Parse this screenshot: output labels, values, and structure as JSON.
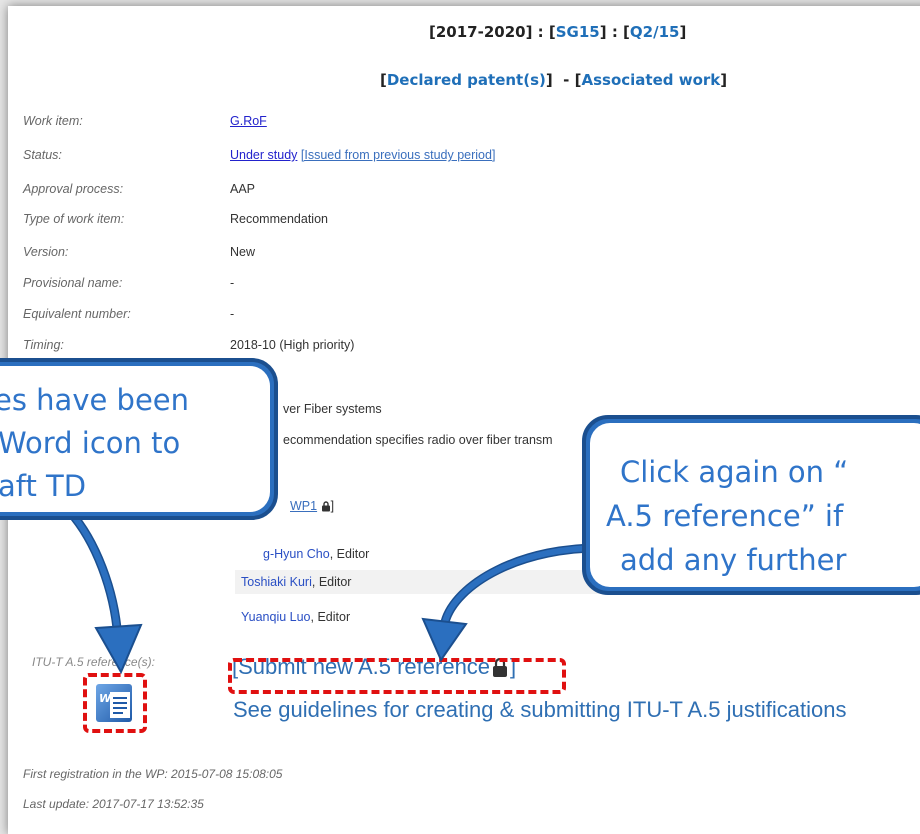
{
  "header": {
    "period": "[2017-2020]",
    "sep1": " : [",
    "study_group": "SG15",
    "sep2": "] : [",
    "question": "Q2/15",
    "end": "]"
  },
  "links": {
    "declared_patents": "Declared patent(s)",
    "associated_work": "Associated work"
  },
  "fields": [
    {
      "label": "Work item:",
      "value": "G.RoF"
    },
    {
      "label": "Status:",
      "value": "Under study",
      "extra": "[Issued from previous study period]"
    },
    {
      "label": "Approval process:",
      "value": "AAP"
    },
    {
      "label": "Type of work item:",
      "value": "Recommendation"
    },
    {
      "label": "Version:",
      "value": "New"
    },
    {
      "label": "Provisional name:",
      "value": "-"
    },
    {
      "label": "Equivalent number:",
      "value": "-"
    },
    {
      "label": "Timing:",
      "value": "2018-10 (High priority)"
    }
  ],
  "partial": {
    "subject": "ver Fiber systems",
    "summary": "ecommendation specifies radio over fiber transm",
    "wp_group": "WP1"
  },
  "editors": [
    {
      "name": "g-Hyun Cho",
      "role": ", Editor"
    },
    {
      "name": "Toshiaki Kuri",
      "role": ", Editor"
    },
    {
      "name": "Yuanqiu Luo",
      "role": ", Editor"
    }
  ],
  "a5": {
    "label": "ITU-T A.5 reference(s):",
    "submit": "Submit new A.5 reference",
    "guidelines": "See guidelines for creating & submitting ITU-T A.5 justifications"
  },
  "footer": {
    "first_registration": "First registration in the WP: 2015-07-08 15:08:05",
    "last_update": "Last update: 2017-07-17 13:52:35"
  },
  "callouts": {
    "left": [
      "es have been",
      "Word icon to",
      "aft TD"
    ],
    "right": [
      "Click again on “",
      "A.5 reference” if",
      "add any further"
    ]
  }
}
